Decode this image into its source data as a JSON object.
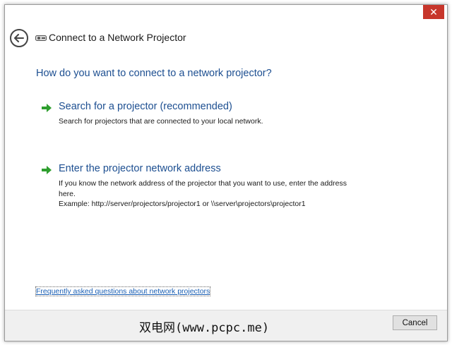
{
  "window": {
    "title": "Connect to a Network Projector",
    "close_label": "✕",
    "back_icon": "back-arrow-icon",
    "title_icon": "network-projector-icon"
  },
  "main_instruction": "How do you want to connect to a network projector?",
  "options": [
    {
      "title": "Search for a projector (recommended)",
      "description_lines": [
        "Search for projectors that are connected to your local network."
      ],
      "icon": "green-arrow-icon"
    },
    {
      "title": "Enter the projector network address",
      "description_lines": [
        "If you know the network address of the projector that you want to use, enter the address",
        "here.",
        "Example: http://server/projectors/projector1 or \\\\server\\projectors\\projector1"
      ],
      "icon": "green-arrow-icon"
    }
  ],
  "faq_link": "Frequently asked questions about network projectors",
  "footer": {
    "watermark": "双电网(www.pcpc.me)",
    "cancel_label": "Cancel"
  },
  "colors": {
    "accent_blue": "#1d4f91",
    "link_blue": "#1a5fb4",
    "close_red": "#c7362b",
    "arrow_green": "#2e9e2e"
  }
}
